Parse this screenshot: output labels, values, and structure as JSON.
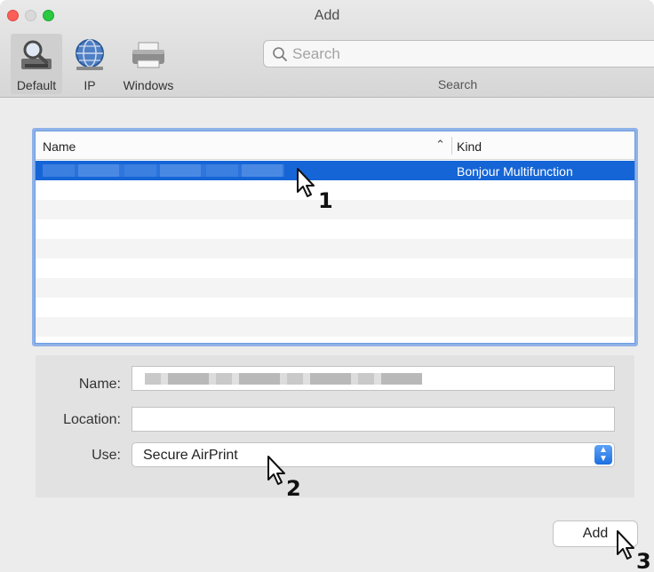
{
  "window": {
    "title": "Add"
  },
  "toolbar": {
    "buttons": [
      {
        "label": "Default",
        "icon": "magnifier-printer-icon"
      },
      {
        "label": "IP",
        "icon": "globe-icon"
      },
      {
        "label": "Windows",
        "icon": "printer-icon"
      }
    ],
    "search": {
      "placeholder": "Search",
      "label": "Search"
    }
  },
  "printer_list": {
    "columns": {
      "name": "Name",
      "kind": "Kind",
      "sort_indicator": "^"
    },
    "selected_row": {
      "kind": "Bonjour Multifunction"
    },
    "empty_rows": 8
  },
  "details": {
    "name_label": "Name:",
    "location_label": "Location:",
    "use_label": "Use:",
    "use_value": "Secure AirPrint"
  },
  "actions": {
    "add_label": "Add"
  },
  "steps": [
    "1",
    "2",
    "3"
  ],
  "colors": {
    "selection": "#1565d6",
    "focus_ring": "#8fb2e8",
    "stepper": "#1c6fe0"
  }
}
